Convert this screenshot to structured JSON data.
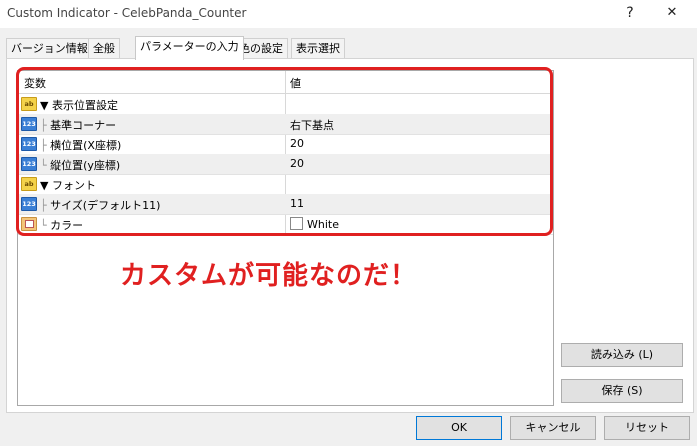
{
  "window": {
    "title": "Custom Indicator - CelebPanda_Counter",
    "help": "?",
    "close": "✕"
  },
  "tabs": [
    {
      "label": "バージョン情報"
    },
    {
      "label": "全般"
    },
    {
      "label": "パラメーターの入力"
    },
    {
      "label": "色の設定"
    },
    {
      "label": "表示選択"
    }
  ],
  "grid": {
    "headers": {
      "variable": "変数",
      "value": "値"
    },
    "rows": [
      {
        "name": "▼ 表示位置設定",
        "value": ""
      },
      {
        "name": "基準コーナー",
        "value": "右下基点"
      },
      {
        "name": "横位置(X座標)",
        "value": "20"
      },
      {
        "name": "縦位置(y座標)",
        "value": "20"
      },
      {
        "name": "▼ フォント",
        "value": ""
      },
      {
        "name": "サイズ(デフォルト11)",
        "value": "11"
      },
      {
        "name": "カラー",
        "value": "White"
      }
    ],
    "tree": {
      "mid": "├",
      "last": "└"
    }
  },
  "annotation": "カスタムが可能なのだ！",
  "buttons": {
    "load": "読み込み (L)",
    "save": "保存 (S)",
    "ok": "OK",
    "cancel": "キャンセル",
    "reset": "リセット"
  },
  "colors": {
    "highlight": "#e02020",
    "annotation": "#e02020"
  }
}
